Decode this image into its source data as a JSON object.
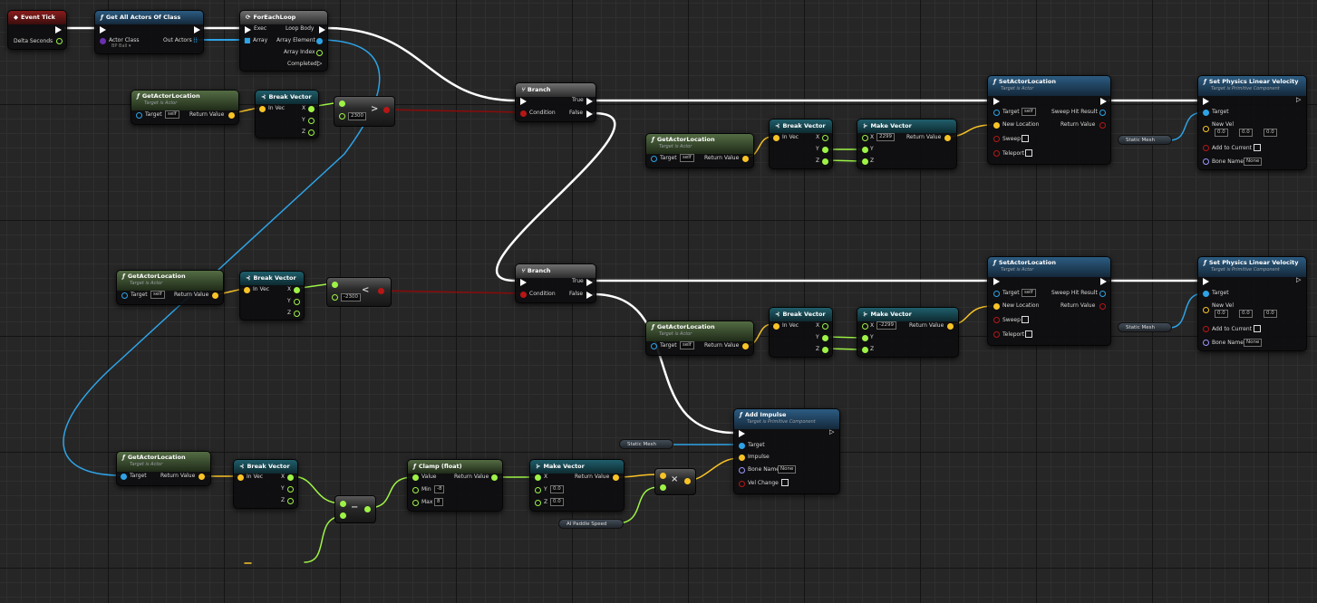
{
  "colors": {
    "exec": "#ffffff",
    "object": "#2ea3e6",
    "vector": "#f8c326",
    "float": "#9ef346",
    "bool": "#8c0a0a",
    "purple": "#9b96ff"
  },
  "event_tick": {
    "title": "Event Tick",
    "pin_delta": "Delta Seconds"
  },
  "get_all": {
    "title": "Get All Actors Of Class",
    "pin_actor_class": "Actor Class",
    "class_value": "BP Ball ▾",
    "pin_out": "Out Actors"
  },
  "foreach": {
    "title": "ForEachLoop",
    "exec": "Exec",
    "array": "Array",
    "loop_body": "Loop Body",
    "array_element": "Array Element",
    "array_index": "Array Index",
    "completed": "Completed"
  },
  "common": {
    "get_loc": "GetActorLocation",
    "target_actor": "Target is Actor",
    "target_prim": "Target is Primitive Component",
    "target": "Target",
    "self": "self",
    "return_value": "Return Value",
    "break_vector": "Break Vector",
    "make_vector": "Make Vector",
    "in_vec": "In Vec",
    "x": "X",
    "y": "Y",
    "z": "Z"
  },
  "branch": {
    "title": "Branch",
    "true": "True",
    "false": "False",
    "condition": "Condition"
  },
  "compare": {
    "top_value": "2300",
    "bottom_value": "-2300"
  },
  "set_loc": {
    "title": "SetActorLocation",
    "new_location": "New Location",
    "sweep": "Sweep",
    "teleport": "Teleport",
    "sweep_hit": "Sweep Hit Result"
  },
  "make_vec_top": {
    "x": "2299"
  },
  "make_vec_mid": {
    "x": "-2299"
  },
  "make_vec_bot": {
    "y": "0.0",
    "z": "0.0"
  },
  "set_vel": {
    "title": "Set Physics Linear Velocity",
    "new_vel": "New Vel",
    "vx": "0.0",
    "vy": "0.0",
    "vz": "0.0",
    "add_to_current": "Add to Current",
    "bone_name": "Bone Name",
    "none": "None"
  },
  "static_mesh": "Static Mesh",
  "impulse": {
    "title": "Add Impulse",
    "impulse": "Impulse",
    "bone_name": "Bone Name",
    "none": "None",
    "vel_change": "Vel Change"
  },
  "clamp": {
    "title": "Clamp (float)",
    "value": "Value",
    "min": "Min",
    "max": "Max",
    "min_val": "-8",
    "max_val": "8"
  },
  "ai_speed": "AI Paddle Speed"
}
